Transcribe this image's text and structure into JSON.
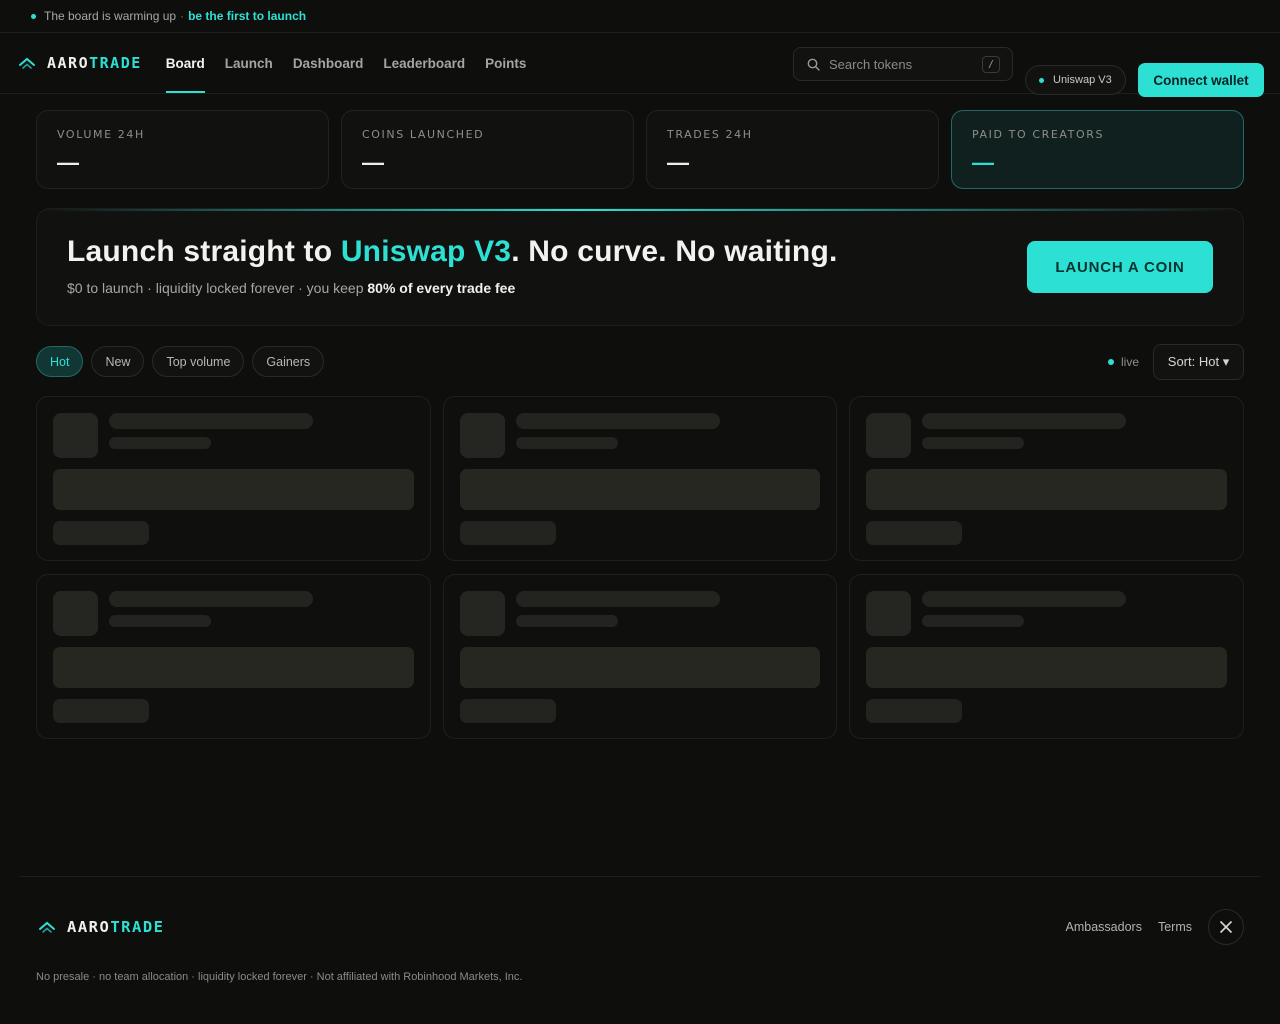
{
  "announcement": {
    "text": "The board is warming up",
    "separator": "·",
    "cta": "be the first to launch"
  },
  "brand": {
    "part1": "AARO",
    "part2": "TRADE"
  },
  "nav": [
    {
      "label": "Board",
      "active": true
    },
    {
      "label": "Launch",
      "active": false
    },
    {
      "label": "Dashboard",
      "active": false
    },
    {
      "label": "Leaderboard",
      "active": false
    },
    {
      "label": "Points",
      "active": false
    }
  ],
  "search": {
    "placeholder": "Search tokens",
    "shortcut": "/"
  },
  "network": {
    "label": "Uniswap V3"
  },
  "connect_label": "Connect wallet",
  "stats": [
    {
      "label": "VOLUME 24H",
      "value": "—"
    },
    {
      "label": "COINS LAUNCHED",
      "value": "—"
    },
    {
      "label": "TRADES 24H",
      "value": "—"
    },
    {
      "label": "PAID TO CREATORS",
      "value": "—"
    }
  ],
  "hero": {
    "title_pre": "Launch straight to ",
    "title_highlight": "Uniswap V3",
    "title_post": ". No curve. No waiting.",
    "sub_pre": "$0 to launch · liquidity locked forever · you keep ",
    "sub_bold": "80% of every trade fee",
    "button": "LAUNCH A COIN"
  },
  "filters": [
    {
      "label": "Hot",
      "active": true
    },
    {
      "label": "New",
      "active": false
    },
    {
      "label": "Top volume",
      "active": false
    },
    {
      "label": "Gainers",
      "active": false
    }
  ],
  "live_label": "live",
  "sort_label": "Sort: Hot ▾",
  "footer": {
    "links": [
      "Ambassadors",
      "Terms"
    ],
    "disclaimer": "No presale · no team allocation · liquidity locked forever · Not affiliated with Robinhood Markets, Inc."
  },
  "colors": {
    "accent": "#2de0d4",
    "background": "#0e0e0d",
    "card": "#111110"
  },
  "icons": [
    "logo-chevron-icon",
    "search-icon",
    "network-dot-icon",
    "live-dot-icon",
    "x-social-icon"
  ]
}
